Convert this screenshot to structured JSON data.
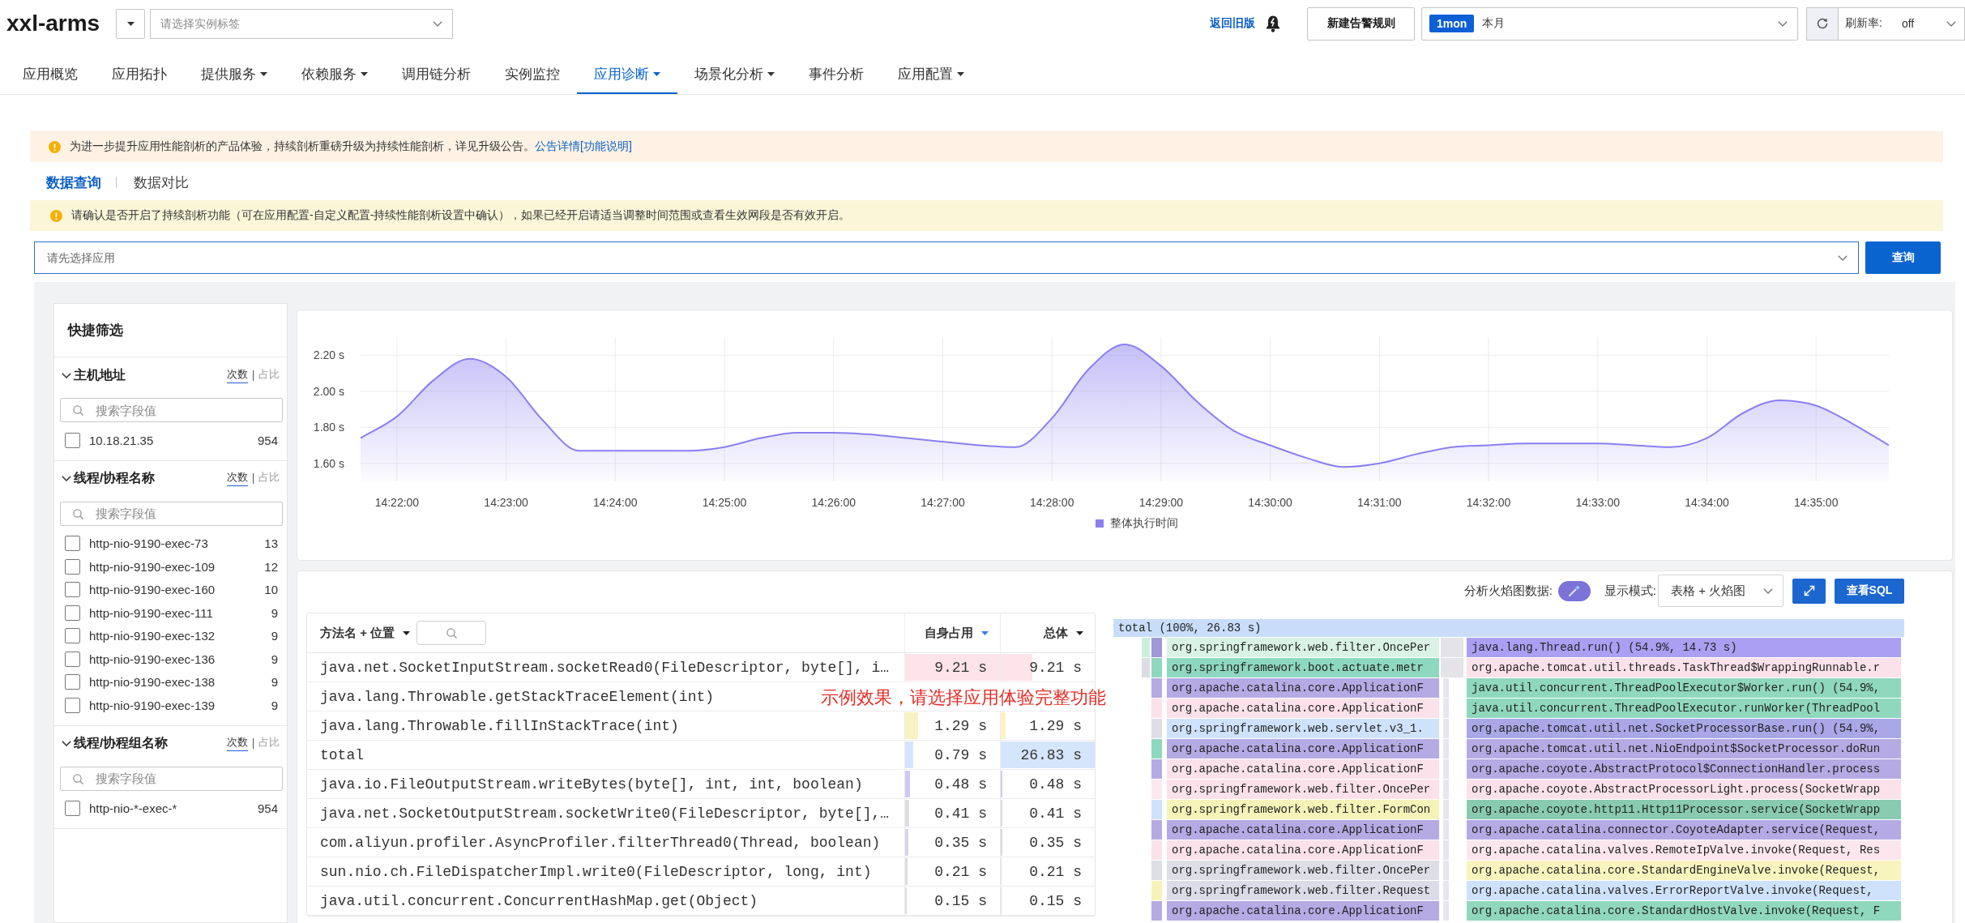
{
  "header": {
    "logo": "xxl-arms",
    "instance_select": {
      "placeholder": "请选择实例标签"
    },
    "old_version_link": "返回旧版",
    "new_alert_button": "新建告警规则",
    "time_range": {
      "tag": "1mon",
      "value": "本月"
    },
    "refresh_rate": {
      "label": "刷新率:",
      "value": "off"
    }
  },
  "nav_tabs": [
    {
      "label": "应用概览",
      "selected": false,
      "dropdown": false
    },
    {
      "label": "应用拓扑",
      "selected": false,
      "dropdown": false
    },
    {
      "label": "提供服务",
      "selected": false,
      "dropdown": true
    },
    {
      "label": "依赖服务",
      "selected": false,
      "dropdown": true
    },
    {
      "label": "调用链分析",
      "selected": false,
      "dropdown": false
    },
    {
      "label": "实例监控",
      "selected": false,
      "dropdown": false
    },
    {
      "label": "应用诊断",
      "selected": true,
      "dropdown": true
    },
    {
      "label": "场景化分析",
      "selected": false,
      "dropdown": true
    },
    {
      "label": "事件分析",
      "selected": false,
      "dropdown": false
    },
    {
      "label": "应用配置",
      "selected": false,
      "dropdown": true
    }
  ],
  "upgrade_notice": {
    "text": "为进一步提升应用性能剖析的产品体验，持续剖析重磅升级为持续性能剖析，详见升级公告。",
    "link": "公告详情[功能说明]"
  },
  "view_tabs": [
    {
      "label": "数据查询",
      "selected": true
    },
    {
      "label": "数据对比",
      "selected": false
    }
  ],
  "warning_notice": {
    "text": "请确认是否开启了持续剖析功能（可在应用配置-自定义配置-持续性能剖析设置中确认），如果已经开启请适当调整时间范围或查看生效网段是否有效开启。"
  },
  "app_select": {
    "placeholder": "请先选择应用"
  },
  "query_button": "查询",
  "quick_filter": {
    "title": "快捷筛选",
    "sections": [
      {
        "title": "主机地址",
        "expanded": true,
        "modes": [
          {
            "label": "次数",
            "selected": true
          },
          {
            "label": "占比",
            "selected": false
          }
        ],
        "search": {
          "placeholder": "搜索字段值"
        },
        "items": [
          {
            "label": "10.18.21.35",
            "count": "954",
            "checked": false
          }
        ]
      },
      {
        "title": "线程/协程名称",
        "expanded": true,
        "modes": [
          {
            "label": "次数",
            "selected": true
          },
          {
            "label": "占比",
            "selected": false
          }
        ],
        "search": {
          "placeholder": "搜索字段值"
        },
        "items": [
          {
            "label": "http-nio-9190-exec-73",
            "count": "13",
            "checked": false
          },
          {
            "label": "http-nio-9190-exec-109",
            "count": "12",
            "checked": false
          },
          {
            "label": "http-nio-9190-exec-160",
            "count": "10",
            "checked": false
          },
          {
            "label": "http-nio-9190-exec-111",
            "count": "9",
            "checked": false
          },
          {
            "label": "http-nio-9190-exec-132",
            "count": "9",
            "checked": false
          },
          {
            "label": "http-nio-9190-exec-136",
            "count": "9",
            "checked": false
          },
          {
            "label": "http-nio-9190-exec-138",
            "count": "9",
            "checked": false
          },
          {
            "label": "http-nio-9190-exec-139",
            "count": "9",
            "checked": false
          }
        ]
      },
      {
        "title": "线程/协程组名称",
        "expanded": true,
        "modes": [
          {
            "label": "次数",
            "selected": true
          },
          {
            "label": "占比",
            "selected": false
          }
        ],
        "search": {
          "placeholder": "搜索字段值"
        },
        "items": [
          {
            "label": "http-nio-*-exec-*",
            "count": "954",
            "checked": false
          }
        ]
      }
    ]
  },
  "trend_chart": {
    "chart_data": {
      "type": "area",
      "categories": [
        null,
        "14:22:00",
        null,
        null,
        "14:23:00",
        null,
        null,
        "14:24:00",
        null,
        null,
        "14:25:00",
        null,
        null,
        "14:26:00",
        null,
        null,
        "14:27:00",
        null,
        null,
        "14:28:00",
        null,
        null,
        "14:29:00",
        null,
        null,
        "14:30:00",
        null,
        null,
        "14:31:00",
        null,
        null,
        "14:32:00",
        null,
        null,
        "14:33:00",
        null,
        null,
        "14:34:00",
        null,
        null,
        "14:35:00",
        null,
        null
      ],
      "series": [
        {
          "name": "整体执行时间",
          "color": "#8b7ff0",
          "values": [
            1.74,
            1.86,
            2.06,
            2.18,
            2.08,
            1.84,
            1.67,
            1.67,
            1.67,
            1.67,
            1.69,
            1.74,
            1.77,
            1.77,
            1.76,
            1.74,
            1.72,
            1.7,
            1.69,
            1.85,
            2.12,
            2.26,
            2.14,
            1.94,
            1.78,
            1.7,
            1.63,
            1.58,
            1.6,
            1.65,
            1.69,
            1.7,
            1.71,
            1.71,
            1.71,
            1.7,
            1.69,
            1.74,
            1.88,
            1.95,
            1.92,
            1.82,
            1.7
          ]
        }
      ],
      "ylim": [
        1.5,
        2.3
      ],
      "yticks": [
        {
          "value": 1.6,
          "label": "1.60 s"
        },
        {
          "value": 1.8,
          "label": "1.80 s"
        },
        {
          "value": 2.0,
          "label": "2.00 s"
        },
        {
          "value": 2.2,
          "label": "2.20 s"
        }
      ],
      "grid": true
    }
  },
  "analysis": {
    "flame_toggle": {
      "label": "分析火焰图数据:",
      "on": true
    },
    "display_mode": {
      "label": "显示模式:",
      "value": "表格 + 火焰图"
    },
    "sql_button": "查看SQL"
  },
  "method_table": {
    "columns": [
      {
        "label": "方法名 + 位置",
        "kind": "name",
        "sort_active": false
      },
      {
        "label": "自身占用",
        "kind": "value",
        "sort_active": true
      },
      {
        "label": "总体",
        "kind": "value",
        "sort_active": false
      }
    ],
    "rows": [
      {
        "method": "java.net.SocketInputStream.socketRead0(FileDescriptor, byte[], i…",
        "color": "#fde3ea",
        "self": {
          "value": "9.21 s",
          "level": 1
        },
        "total": {
          "value": "9.21 s",
          "level": 0.34
        }
      },
      {
        "method": "java.lang.Throwable.getStackTraceElement(int)"
      },
      {
        "method": "java.lang.Throwable.fillInStackTrace(int)",
        "color": "#f8f3c4",
        "self": {
          "value": "1.29 s",
          "level": 0.14
        },
        "total": {
          "value": "1.29 s",
          "level": 0.048
        }
      },
      {
        "method": "total",
        "color": "#d5e5fb",
        "self": {
          "value": "0.79 s",
          "level": 0.086
        },
        "total": {
          "value": "26.83 s",
          "level": 1
        }
      },
      {
        "method": "java.io.FileOutputStream.writeBytes(byte[], int, int, boolean)",
        "color": "#cfc9f4",
        "self": {
          "value": "0.48 s",
          "level": 0.052
        },
        "total": {
          "value": "0.48 s",
          "level": 0.018
        }
      },
      {
        "method": "java.net.SocketOutputStream.socketWrite0(FileDescriptor, byte[],…",
        "color": "#dcdce6",
        "self": {
          "value": "0.41 s",
          "level": 0.045
        },
        "total": {
          "value": "0.41 s",
          "level": 0.015
        }
      },
      {
        "method": "com.aliyun.profiler.AsyncProfiler.filterThread0(Thread, boolean)",
        "color": "#d6d6e2",
        "self": {
          "value": "0.35 s",
          "level": 0.038
        },
        "total": {
          "value": "0.35 s",
          "level": 0.013
        }
      },
      {
        "method": "sun.nio.ch.FileDispatcherImpl.write0(FileDescriptor, long, int)",
        "color": "#dcdce6",
        "self": {
          "value": "0.21 s",
          "level": 0.023
        },
        "total": {
          "value": "0.21 s",
          "level": 0.008
        }
      },
      {
        "method": "java.util.concurrent.ConcurrentHashMap.get(Object)",
        "color": "#dcdce6",
        "self": {
          "value": "0.15 s",
          "level": 0.016
        },
        "total": {
          "value": "0.15 s",
          "level": 0.006
        }
      }
    ]
  },
  "overlay_notice": "示例效果，请选择应用体验完整功能",
  "flame_graph": {
    "root": {
      "label": "total (100%, 26.83 s)",
      "color": "#c8ddf9"
    },
    "rows": [
      {
        "frames": [
          {
            "kind": "edge",
            "color": "#cdeede"
          },
          {
            "kind": "narrow",
            "color": "#9f98d8"
          },
          {
            "kind": "main",
            "color": "#d9f2e5",
            "label": "org.springframework.web.filter.OncePer"
          },
          {
            "kind": "block",
            "color": "#e3e3e8"
          },
          {
            "kind": "wide",
            "color": "#aa9ff2",
            "label": "java.lang.Thread.run() (54.9%, 14.73 s)"
          }
        ]
      },
      {
        "frames": [
          {
            "kind": "edge",
            "color": "#dcdce2"
          },
          {
            "kind": "narrow",
            "color": "#8fd8c0"
          },
          {
            "kind": "main",
            "color": "#8fd8c0",
            "label": "org.springframework.boot.actuate.metr"
          },
          {
            "kind": "block",
            "color": "#e3e3e8"
          },
          {
            "kind": "wide",
            "color": "#fbe1ea",
            "label": "org.apache.tomcat.util.threads.TaskThread$WrappingRunnable.r"
          }
        ]
      },
      {
        "frames": [
          {
            "kind": "narrow",
            "color": "#b6aae4"
          },
          {
            "kind": "main",
            "color": "#b6aae4",
            "label": "org.apache.catalina.core.ApplicationF"
          },
          {
            "kind": "sliver",
            "color": "#e6e6ec"
          },
          {
            "kind": "wide",
            "color": "#8fd8bd",
            "label": "java.util.concurrent.ThreadPoolExecutor$Worker.run() (54.9%,"
          }
        ]
      },
      {
        "frames": [
          {
            "kind": "narrow",
            "color": "#fbe1ea"
          },
          {
            "kind": "main",
            "color": "#fbe1ea",
            "label": "org.apache.catalina.core.ApplicationF"
          },
          {
            "kind": "sliver",
            "color": "#e6e6ec"
          },
          {
            "kind": "wide",
            "color": "#8fd8bd",
            "label": "java.util.concurrent.ThreadPoolExecutor.runWorker(ThreadPool"
          }
        ]
      },
      {
        "frames": [
          {
            "kind": "narrow",
            "color": "#dedee6"
          },
          {
            "kind": "main",
            "color": "#cfe2fb",
            "label": "org.springframework.web.servlet.v3_1."
          },
          {
            "kind": "sliver",
            "color": "#e6e6ec"
          },
          {
            "kind": "wide",
            "color": "#a9a7e6",
            "label": "org.apache.tomcat.util.net.SocketProcessorBase.run() (54.9%,"
          }
        ]
      },
      {
        "frames": [
          {
            "kind": "narrow",
            "color": "#8fd8c0"
          },
          {
            "kind": "main",
            "color": "#b6aae4",
            "label": "org.apache.catalina.core.ApplicationF"
          },
          {
            "kind": "sliver",
            "color": "#e6e6ec"
          },
          {
            "kind": "wide",
            "color": "#b6aae4",
            "label": "org.apache.tomcat.util.net.NioEndpoint$SocketProcessor.doRun"
          }
        ]
      },
      {
        "frames": [
          {
            "kind": "narrow",
            "color": "#b6aae4"
          },
          {
            "kind": "main",
            "color": "#fbe1ea",
            "label": "org.apache.catalina.core.ApplicationF"
          },
          {
            "kind": "sliver",
            "color": "#e6e6ec"
          },
          {
            "kind": "wide",
            "color": "#b6aae4",
            "label": "org.apache.coyote.AbstractProtocol$ConnectionHandler.process"
          }
        ]
      },
      {
        "frames": [
          {
            "kind": "narrow",
            "color": "#fce8ef"
          },
          {
            "kind": "main",
            "color": "#fbe1ea",
            "label": "org.springframework.web.filter.OncePer"
          },
          {
            "kind": "sliver",
            "color": "#e6e6ec"
          },
          {
            "kind": "wide",
            "color": "#fbe1ea",
            "label": "org.apache.coyote.AbstractProcessorLight.process(SocketWrapp"
          }
        ]
      },
      {
        "frames": [
          {
            "kind": "narrow",
            "color": "#cfe2fb"
          },
          {
            "kind": "main",
            "color": "#f6f3b8",
            "label": "org.springframework.web.filter.FormCon"
          },
          {
            "kind": "sliver",
            "color": "#e6e6ec"
          },
          {
            "kind": "wide",
            "color": "#88cbb0",
            "label": "org.apache.coyote.http11.Http11Processor.service(SocketWrapp"
          }
        ]
      },
      {
        "frames": [
          {
            "kind": "narrow",
            "color": "#b6aae4"
          },
          {
            "kind": "main",
            "color": "#b6aae4",
            "label": "org.apache.catalina.core.ApplicationF"
          },
          {
            "kind": "sliver",
            "color": "#e6e6ec"
          },
          {
            "kind": "wide",
            "color": "#b6aae4",
            "label": "org.apache.catalina.connector.CoyoteAdapter.service(Request,"
          }
        ]
      },
      {
        "frames": [
          {
            "kind": "narrow",
            "color": "#fbe1ea"
          },
          {
            "kind": "main",
            "color": "#fbe1ea",
            "label": "org.apache.catalina.core.ApplicationF"
          },
          {
            "kind": "sliver",
            "color": "#e6e6ec"
          },
          {
            "kind": "wide",
            "color": "#fce6ee",
            "label": "org.apache.catalina.valves.RemoteIpValve.invoke(Request, Res"
          }
        ]
      },
      {
        "frames": [
          {
            "kind": "narrow",
            "color": "#dedee6"
          },
          {
            "kind": "main",
            "color": "#dedee6",
            "label": "org.springframework.web.filter.OncePer"
          },
          {
            "kind": "sliver",
            "color": "#e6e6ec"
          },
          {
            "kind": "wide",
            "color": "#f7f4bd",
            "label": "org.apache.catalina.core.StandardEngineValve.invoke(Request,"
          }
        ]
      },
      {
        "frames": [
          {
            "kind": "narrow",
            "color": "#f6f3b8"
          },
          {
            "kind": "main",
            "color": "#dcdbe8",
            "label": "org.springframework.web.filter.Request"
          },
          {
            "kind": "sliver",
            "color": "#e6e6ec"
          },
          {
            "kind": "wide",
            "color": "#cfe2fb",
            "label": "org.apache.catalina.valves.ErrorReportValve.invoke(Request,"
          }
        ]
      },
      {
        "frames": [
          {
            "kind": "narrow",
            "color": "#b6aae4"
          },
          {
            "kind": "main",
            "color": "#b6aae4",
            "label": "org.apache.catalina.core.ApplicationF"
          },
          {
            "kind": "sliver",
            "color": "#e6e6ec"
          },
          {
            "kind": "wide",
            "color": "#8fd8bd",
            "label": "org.apache.catalina.core.StandardHostValve.invoke(Request, F"
          }
        ]
      }
    ]
  }
}
